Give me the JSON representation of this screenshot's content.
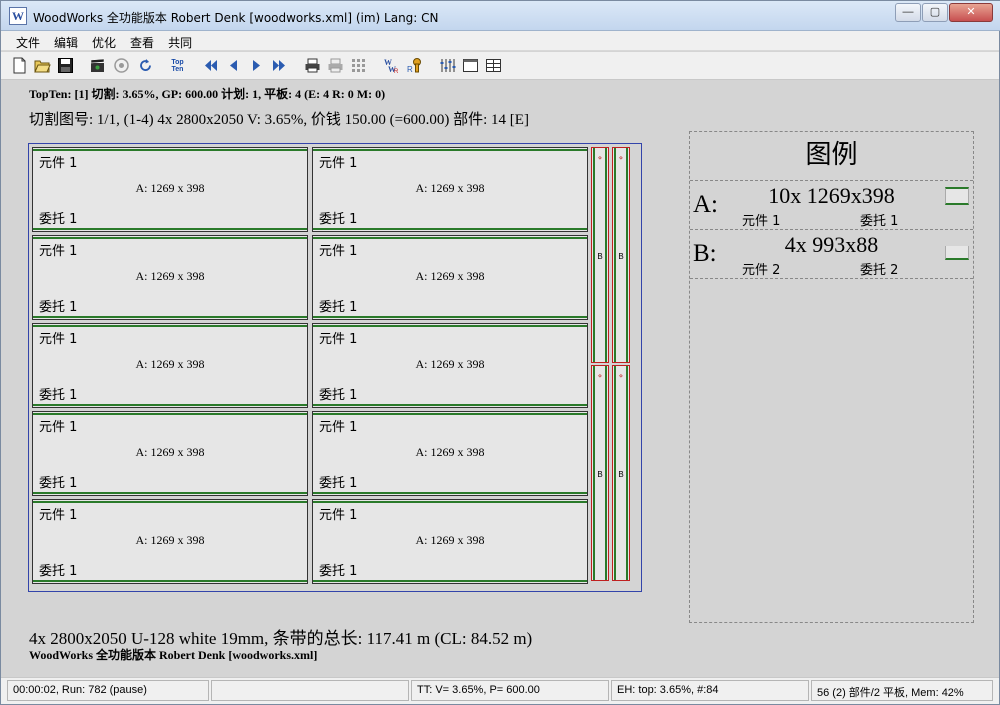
{
  "window": {
    "title": "WoodWorks 全功能版本 Robert Denk [woodworks.xml] (im) Lang: CN",
    "logo_icon": "woodworks-logo-icon",
    "controls": {
      "minimize": "—",
      "maximize": "▢",
      "close": "✕"
    }
  },
  "menu": [
    "文件",
    "编辑",
    "优化",
    "查看",
    "共同"
  ],
  "toolbar": {
    "topten_label_1": "Top",
    "topten_label_2": "Ten",
    "buttons": [
      "new-file-icon",
      "open-folder-icon",
      "save-icon",
      "clapper-icon",
      "target-icon",
      "refresh-icon",
      "topten-icon",
      "first-icon",
      "prev-icon",
      "next-icon",
      "last-icon",
      "print-icon",
      "print-preview-icon",
      "grid-icon",
      "wrk-icon",
      "settings-sliders-icon",
      "window-icon",
      "layout-icon"
    ]
  },
  "info": {
    "line1": "TopTen: [1] 切割: 3.65%, GP: 600.00 计划: 1, 平板: 4 (E: 4 R: 0 M: 0)",
    "line2": "切割图号: 1/1, (1-4) 4x 2800x2050 V: 3.65%, 价钱 150.00 (=600.00) 部件: 14    [E]"
  },
  "sheet": {
    "piece_name": "元件 1",
    "piece_dims": "A: 1269 x 398",
    "piece_customer": "委托 1",
    "strip_label": "B",
    "strip_marker": "⋄"
  },
  "legend": {
    "title": "图例",
    "rows": [
      {
        "letter": "A:",
        "count": "10x 1269x398",
        "name": "元件 1",
        "customer": "委托 1"
      },
      {
        "letter": "B:",
        "count": "4x 993x88",
        "name": "元件 2",
        "customer": "委托 2"
      }
    ]
  },
  "material": "4x 2800x2050 U-128 white 19mm, 条带的总长: 117.41 m (CL: 84.52 m)",
  "footer": "WoodWorks 全功能版本 Robert Denk [woodworks.xml]",
  "status": [
    "00:00:02, Run: 782 (pause)",
    "",
    "TT: V= 3.65%, P= 600.00",
    "EH: top: 3.65%,  #:84",
    "56 (2) 部件/2 平板, Mem: 42%"
  ],
  "colors": {
    "edge_band": "#2a7a2a",
    "strip_border": "#c02020",
    "sheet_border": "#3344aa"
  }
}
